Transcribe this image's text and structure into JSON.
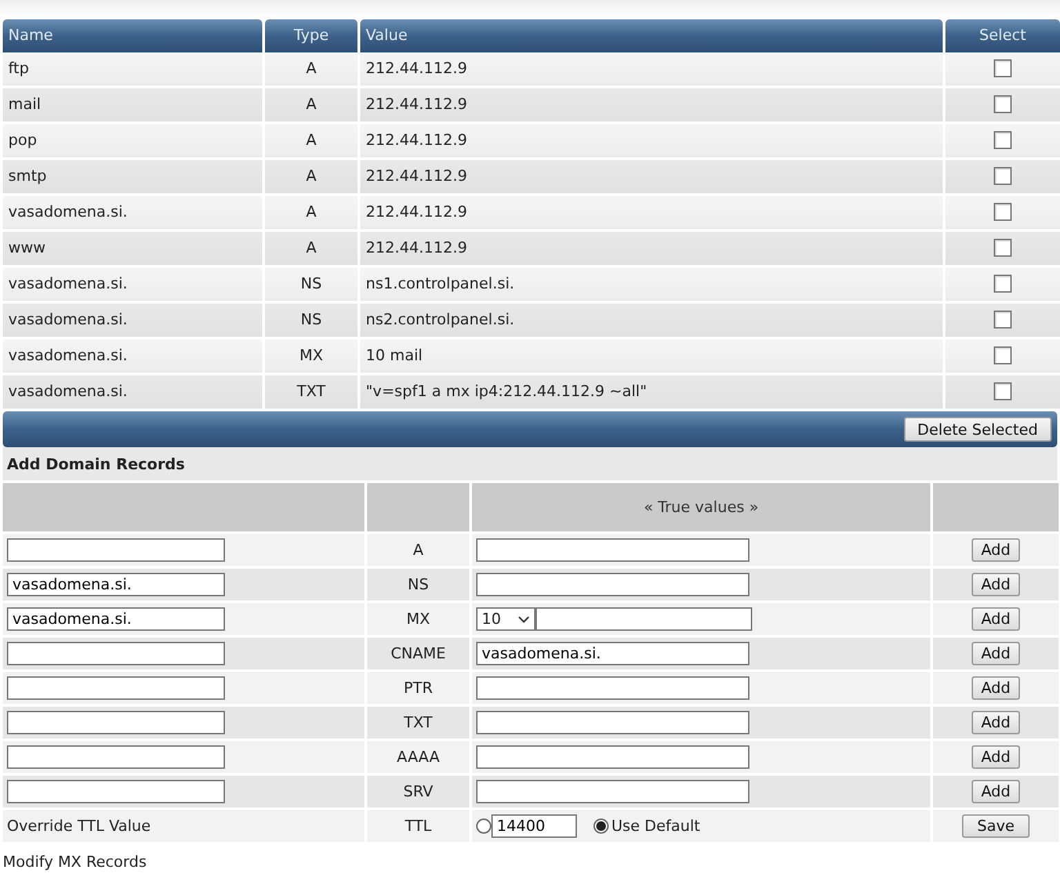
{
  "records_table": {
    "columns": [
      "Name",
      "Type",
      "Value",
      "Select"
    ],
    "rows": [
      {
        "name": "ftp",
        "type": "A",
        "value": "212.44.112.9",
        "checked": false
      },
      {
        "name": "mail",
        "type": "A",
        "value": "212.44.112.9",
        "checked": false
      },
      {
        "name": "pop",
        "type": "A",
        "value": "212.44.112.9",
        "checked": false
      },
      {
        "name": "smtp",
        "type": "A",
        "value": "212.44.112.9",
        "checked": false
      },
      {
        "name": "vasadomena.si.",
        "type": "A",
        "value": "212.44.112.9",
        "checked": false
      },
      {
        "name": "www",
        "type": "A",
        "value": "212.44.112.9",
        "checked": false
      },
      {
        "name": "vasadomena.si.",
        "type": "NS",
        "value": "ns1.controlpanel.si.",
        "checked": false
      },
      {
        "name": "vasadomena.si.",
        "type": "NS",
        "value": "ns2.controlpanel.si.",
        "checked": false
      },
      {
        "name": "vasadomena.si.",
        "type": "MX",
        "value": "10 mail",
        "checked": false
      },
      {
        "name": "vasadomena.si.",
        "type": "TXT",
        "value": "\"v=spf1 a mx ip4:212.44.112.9 ~all\"",
        "checked": false
      }
    ],
    "delete_button": "Delete Selected"
  },
  "add_records": {
    "title": "Add Domain Records",
    "value_header": "« True values »",
    "rows": [
      {
        "kind": "plain",
        "type": "A",
        "button": "Add"
      },
      {
        "kind": "plain",
        "type": "NS",
        "name_value": "vasadomena.si.",
        "button": "Add"
      },
      {
        "kind": "priority",
        "type": "MX",
        "name_value": "vasadomena.si.",
        "priority": "10",
        "button": "Add"
      },
      {
        "kind": "plain",
        "type": "CNAME",
        "value": "vasadomena.si.",
        "button": "Add"
      },
      {
        "kind": "plain",
        "type": "PTR",
        "button": "Add"
      },
      {
        "kind": "plain",
        "type": "TXT",
        "button": "Add"
      },
      {
        "kind": "plain",
        "type": "AAAA",
        "button": "Add"
      },
      {
        "kind": "plain",
        "type": "SRV",
        "button": "Add"
      }
    ],
    "ttl": {
      "label": "Override TTL Value",
      "type": "TTL",
      "options": [
        {
          "kind": "custom",
          "value": "14400",
          "selected": false
        },
        {
          "kind": "default",
          "label": "Use Default",
          "selected": true
        }
      ],
      "button": "Save"
    }
  },
  "footer_link": "Modify MX Records"
}
